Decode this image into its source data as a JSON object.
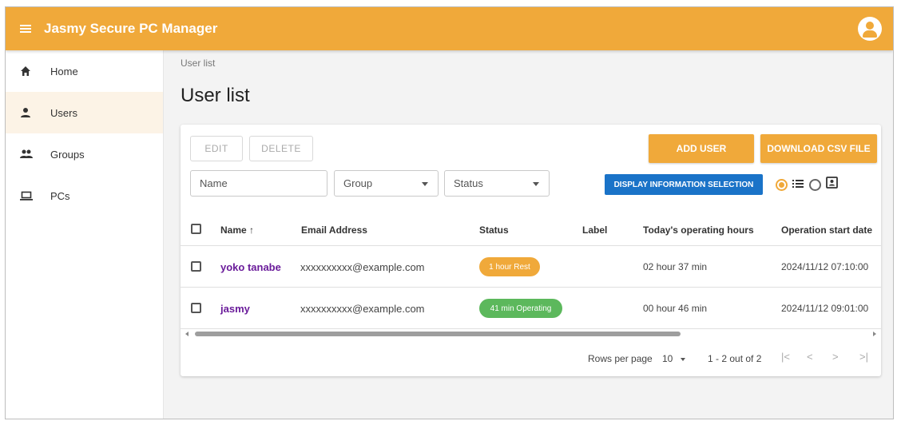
{
  "app": {
    "title": "Jasmy Secure PC Manager"
  },
  "sidebar": {
    "items": [
      {
        "label": "Home",
        "icon": "home-icon"
      },
      {
        "label": "Users",
        "icon": "user-icon",
        "active": true
      },
      {
        "label": "Groups",
        "icon": "group-icon"
      },
      {
        "label": "PCs",
        "icon": "laptop-icon"
      }
    ]
  },
  "breadcrumb": "User list",
  "page_title": "User list",
  "toolbar": {
    "edit_label": "EDIT",
    "delete_label": "DELETE",
    "add_user_label": "ADD USER",
    "download_csv_label": "DOWNLOAD CSV FILE",
    "display_info_label": "DISPLAY INFORMATION SELECTION",
    "view_mode": "list"
  },
  "filters": {
    "name_placeholder": "Name",
    "group_placeholder": "Group",
    "status_placeholder": "Status"
  },
  "table": {
    "columns": [
      "Name ↑",
      "Email Address",
      "Status",
      "Label",
      "Today's operating hours",
      "Operation start date"
    ],
    "rows": [
      {
        "name": "yoko tanabe",
        "email": "xxxxxxxxxx@example.com",
        "status": "1 hour Rest",
        "status_color": "#f0a93a",
        "label": "",
        "hours": "02 hour 37 min",
        "start": "2024/11/12 07:10:00"
      },
      {
        "name": "jasmy",
        "email": "xxxxxxxxxx@example.com",
        "status": "41 min Operating",
        "status_color": "#5cb85c",
        "label": "",
        "hours": "00 hour 46 min",
        "start": "2024/11/12 09:01:00"
      }
    ]
  },
  "pagination": {
    "rows_per_page_label": "Rows per page",
    "rows_per_page": "10",
    "range": "1 - 2 out of 2"
  },
  "colors": {
    "accent": "#f0a93a",
    "blue": "#1a73c8",
    "link": "#6a1b9a",
    "operating": "#5cb85c"
  }
}
